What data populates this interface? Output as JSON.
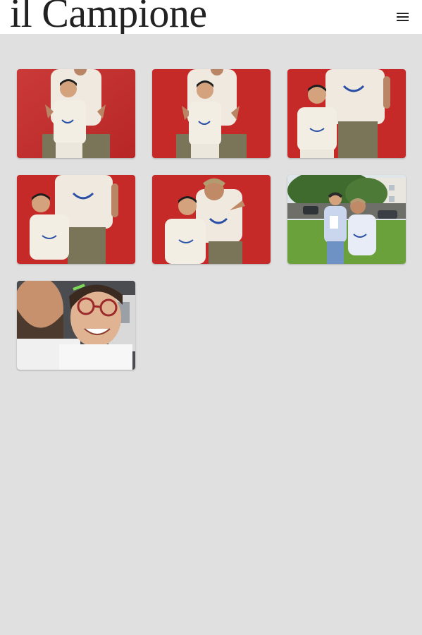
{
  "header": {
    "logo_text": "il Campione",
    "menu_icon": "hamburger-menu-icon"
  },
  "gallery": {
    "photos": [
      {
        "scene": "red-wall",
        "pose": "child-front"
      },
      {
        "scene": "red-wall",
        "pose": "child-front"
      },
      {
        "scene": "red-wall",
        "pose": "side-by-side"
      },
      {
        "scene": "red-wall",
        "pose": "side-by-side"
      },
      {
        "scene": "red-wall",
        "pose": "pointing"
      },
      {
        "scene": "park",
        "pose": "outdoor"
      },
      {
        "scene": "selfie",
        "pose": "close-up"
      }
    ]
  },
  "colors": {
    "header_bg": "#ffffff",
    "page_bg": "#e0e0e0",
    "wall_red": "#c62a28",
    "shirt_cream": "#f1ece2",
    "logo_blue": "#2a4fa6"
  }
}
